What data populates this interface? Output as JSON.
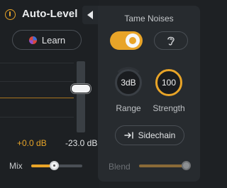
{
  "header": {
    "title": "Auto-Level",
    "power_icon": "power-icon",
    "collapse_icon": "chevron-left-icon"
  },
  "learn": {
    "label": "Learn",
    "icon": "learn-icon"
  },
  "meter": {
    "gain_readout": "+0.0 dB",
    "threshold_readout": "-23.0 dB"
  },
  "mix": {
    "label": "Mix",
    "value_fraction": 0.45
  },
  "tame_noises": {
    "title": "Tame Noises",
    "toggle_on": true,
    "ear_icon": "ear-icon",
    "range": {
      "value": "3dB",
      "label": "Range"
    },
    "strength": {
      "value": "100",
      "label": "Strength"
    },
    "sidechain": {
      "label": "Sidechain",
      "icon": "sidechain-arrow-icon"
    },
    "blend": {
      "label": "Blend",
      "value_fraction": 1.0
    }
  },
  "colors": {
    "accent": "#e8a428",
    "background": "#1e2124",
    "panel": "#272b2f"
  }
}
